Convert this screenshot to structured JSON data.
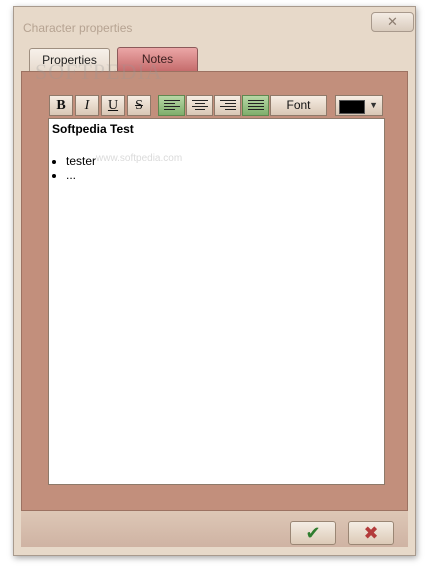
{
  "window": {
    "title": "Character properties",
    "close_label": "✕"
  },
  "tabs": [
    {
      "label": "Properties"
    },
    {
      "label": "Notes"
    }
  ],
  "toolbar": {
    "bold": "B",
    "italic": "I",
    "underline": "U",
    "strike": "S",
    "font_label": "Font",
    "color": "#000000"
  },
  "editor": {
    "heading": "Softpedia Test",
    "items": [
      "tester",
      "..."
    ]
  },
  "footer": {
    "ok_label": "✔",
    "cancel_label": "✖"
  },
  "watermark": {
    "logo": "SOFTPEDIA",
    "url": "www.softpedia.com"
  }
}
